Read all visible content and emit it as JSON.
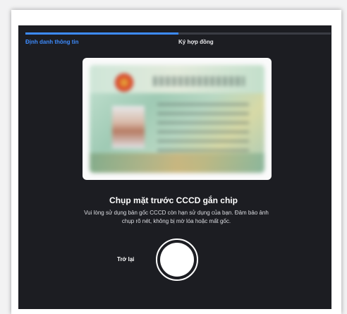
{
  "progress": {
    "value": 0.5,
    "accent_color": "#3d8bfd",
    "steps": [
      {
        "label": "Định danh thông tin",
        "active": true
      },
      {
        "label": "Ký hợp đồng",
        "active": false
      }
    ]
  },
  "capture": {
    "heading": "Chụp mặt trước CCCD gắn chip",
    "description": "Vui lòng sử dụng bản gốc CCCD còn hạn sử dụng của bạn. Đảm bảo ảnh chụp rõ nét, không bị mờ lóa hoặc mất gốc."
  },
  "actions": {
    "back_label": "Trở lại",
    "shutter_icon": "camera-shutter-icon"
  }
}
